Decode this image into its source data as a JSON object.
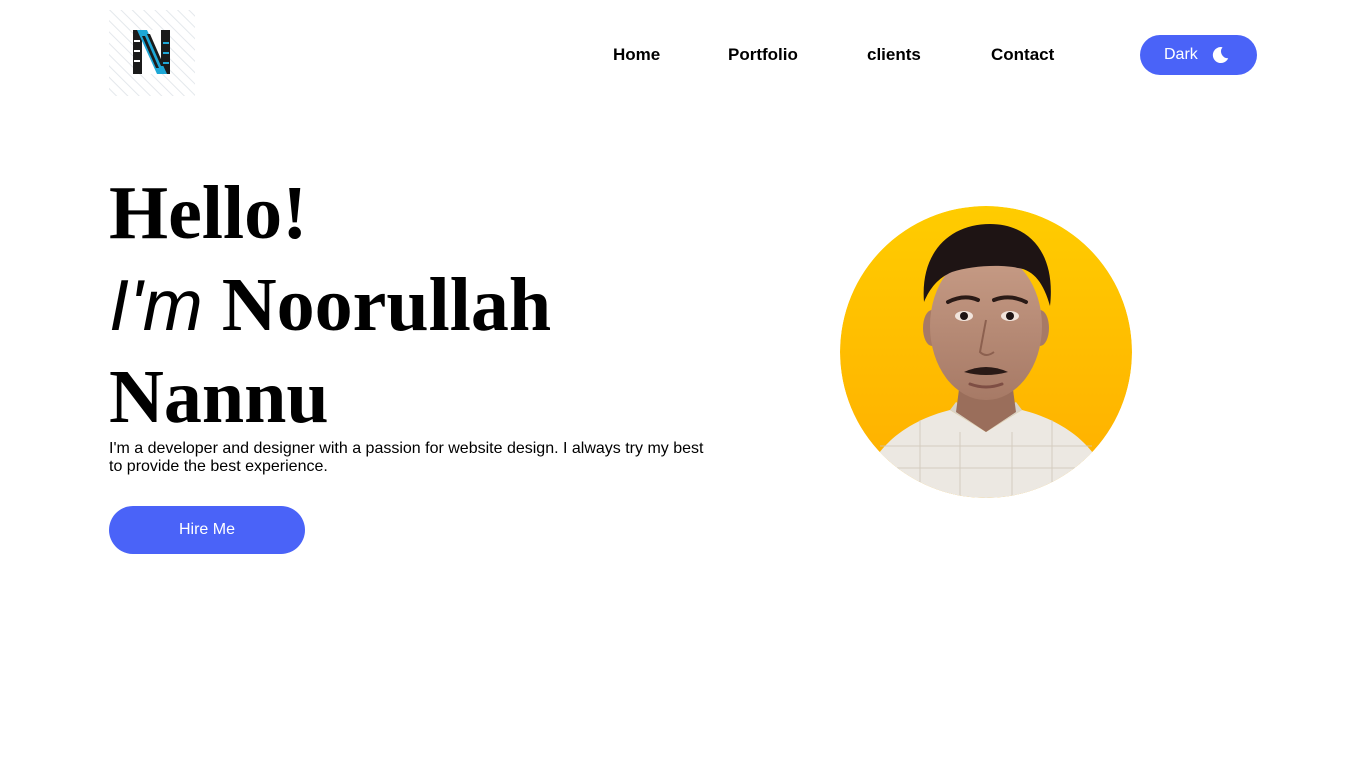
{
  "header": {
    "logo_icon": "n-monogram-logo",
    "nav": [
      "Home",
      "Portfolio",
      "clients",
      "Contact"
    ],
    "theme_toggle": {
      "label": "Dark",
      "icon": "moon-icon"
    }
  },
  "hero": {
    "greeting": "Hello!",
    "im": "I'm",
    "first_name": "Noorullah",
    "last_name": "Nannu",
    "intro": "I'm a developer and designer with a passion for website design. I always try my best to provide the best experience.",
    "cta_label": "Hire Me"
  },
  "profile": {
    "photo_icon": "profile-photo"
  },
  "colors": {
    "accent": "#4a63f8",
    "photo_background": "#ffc107",
    "text": "#000000",
    "background": "#ffffff"
  }
}
